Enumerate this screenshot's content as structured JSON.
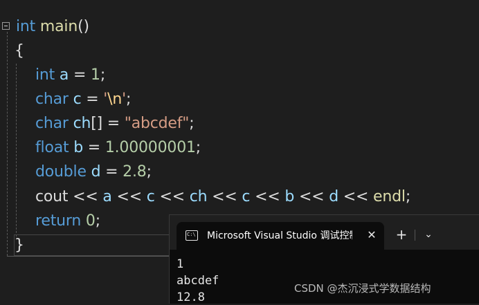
{
  "editor": {
    "lines": [
      {
        "tokens": [
          {
            "t": "int",
            "c": "kw"
          },
          {
            "t": " ",
            "c": "plain"
          },
          {
            "t": "main",
            "c": "fn"
          },
          {
            "t": "()",
            "c": "plain"
          }
        ]
      },
      {
        "tokens": [
          {
            "t": "{",
            "c": "plain"
          }
        ]
      },
      {
        "tokens": [
          {
            "t": "int",
            "c": "kw"
          },
          {
            "t": " ",
            "c": "plain"
          },
          {
            "t": "a",
            "c": "var"
          },
          {
            "t": " = ",
            "c": "plain"
          },
          {
            "t": "1",
            "c": "num"
          },
          {
            "t": ";",
            "c": "plain"
          }
        ]
      },
      {
        "tokens": [
          {
            "t": "char",
            "c": "kw"
          },
          {
            "t": " ",
            "c": "plain"
          },
          {
            "t": "c",
            "c": "var"
          },
          {
            "t": " = ",
            "c": "plain"
          },
          {
            "t": "'",
            "c": "str"
          },
          {
            "t": "\\n",
            "c": "esc"
          },
          {
            "t": "'",
            "c": "str"
          },
          {
            "t": ";",
            "c": "plain"
          }
        ]
      },
      {
        "tokens": [
          {
            "t": "char",
            "c": "kw"
          },
          {
            "t": " ",
            "c": "plain"
          },
          {
            "t": "ch",
            "c": "var"
          },
          {
            "t": "[] = ",
            "c": "plain"
          },
          {
            "t": "\"abcdef\"",
            "c": "str"
          },
          {
            "t": ";",
            "c": "plain"
          }
        ]
      },
      {
        "tokens": [
          {
            "t": "float",
            "c": "kw"
          },
          {
            "t": " ",
            "c": "plain"
          },
          {
            "t": "b",
            "c": "var"
          },
          {
            "t": " = ",
            "c": "plain"
          },
          {
            "t": "1.00000001",
            "c": "num"
          },
          {
            "t": ";",
            "c": "plain"
          }
        ]
      },
      {
        "tokens": [
          {
            "t": "double",
            "c": "kw"
          },
          {
            "t": " ",
            "c": "plain"
          },
          {
            "t": "d",
            "c": "var"
          },
          {
            "t": " = ",
            "c": "plain"
          },
          {
            "t": "2.8",
            "c": "num"
          },
          {
            "t": ";",
            "c": "plain"
          }
        ]
      },
      {
        "tokens": [
          {
            "t": "cout",
            "c": "plain"
          },
          {
            "t": " << ",
            "c": "plain"
          },
          {
            "t": "a",
            "c": "var"
          },
          {
            "t": " << ",
            "c": "plain"
          },
          {
            "t": "c",
            "c": "var"
          },
          {
            "t": " << ",
            "c": "plain"
          },
          {
            "t": "ch",
            "c": "var"
          },
          {
            "t": " << ",
            "c": "plain"
          },
          {
            "t": "c",
            "c": "var"
          },
          {
            "t": " << ",
            "c": "plain"
          },
          {
            "t": "b",
            "c": "var"
          },
          {
            "t": " << ",
            "c": "plain"
          },
          {
            "t": "d",
            "c": "var"
          },
          {
            "t": " << ",
            "c": "plain"
          },
          {
            "t": "endl",
            "c": "fn"
          },
          {
            "t": ";",
            "c": "plain"
          }
        ]
      },
      {
        "tokens": [
          {
            "t": "return",
            "c": "kw"
          },
          {
            "t": " ",
            "c": "plain"
          },
          {
            "t": "0",
            "c": "num"
          },
          {
            "t": ";",
            "c": "plain"
          }
        ]
      },
      {
        "tokens": [
          {
            "t": "}",
            "c": "plain"
          }
        ]
      }
    ]
  },
  "console": {
    "tab_title": "Microsoft Visual Studio 调试控制台",
    "tab_icon_text": "C:\\",
    "close_glyph": "✕",
    "new_tab_glyph": "+",
    "dropdown_glyph": "⌄",
    "output": [
      "1",
      "abcdef",
      "12.8"
    ]
  },
  "watermark": "CSDN @杰沉浸式学数据结构",
  "colors": {
    "keyword": "#569cd6",
    "function": "#dcdcaa",
    "variable": "#9cdcfe",
    "number": "#b5cea8",
    "string": "#d69d85",
    "escape": "#ffd68f",
    "text": "#dcdcdc",
    "background": "#1e1e1e"
  }
}
